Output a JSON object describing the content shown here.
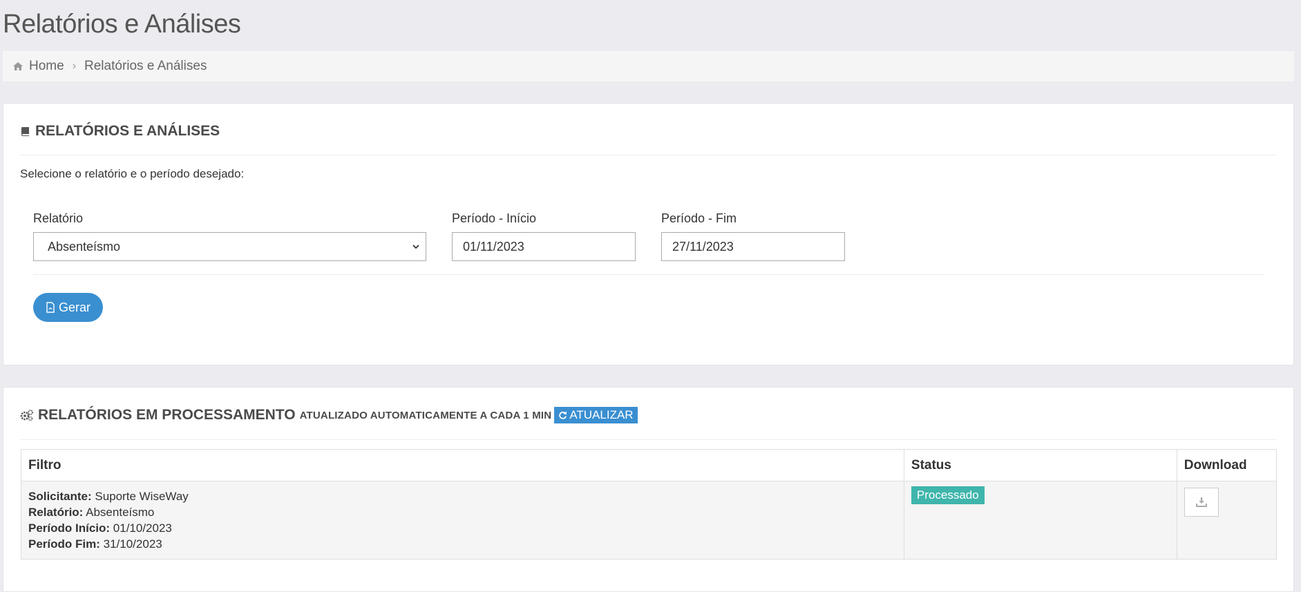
{
  "page": {
    "title": "Relatórios e Análises"
  },
  "breadcrumb": {
    "home": "Home",
    "current": "Relatórios e Análises",
    "home_icon": "home-icon",
    "separator_icon": "chevron-right-icon"
  },
  "form_card": {
    "title": "RELATÓRIOS E ANÁLISES",
    "icon": "book-icon",
    "instruction": "Selecione o relatório e o período desejado:",
    "report_label": "Relatório",
    "report_value": "Absenteísmo",
    "start_label": "Período - Início",
    "start_value": "01/11/2023",
    "end_label": "Período - Fim",
    "end_value": "27/11/2023",
    "generate_label": "Gerar",
    "generate_icon": "file-pdf-icon"
  },
  "processing_card": {
    "title": "RELATÓRIOS EM PROCESSAMENTO",
    "icon": "gears-icon",
    "subtitle": "ATUALIZADO AUTOMATICAMENTE A CADA 1 MIN",
    "refresh_label": "ATUALIZAR",
    "refresh_icon": "refresh-icon",
    "columns": {
      "filter": "Filtro",
      "status": "Status",
      "download": "Download"
    },
    "rows": [
      {
        "solicitante_label": "Solicitante:",
        "solicitante": "Suporte WiseWay",
        "relatorio_label": "Relatório:",
        "relatorio": "Absenteísmo",
        "inicio_label": "Período Início:",
        "inicio": "01/10/2023",
        "fim_label": "Período Fim:",
        "fim": "31/10/2023",
        "status": "Processado",
        "download_icon": "download-icon"
      }
    ]
  },
  "colors": {
    "accent": "#3a8fd1",
    "success": "#3fb5ab",
    "background": "#ebebf0"
  }
}
